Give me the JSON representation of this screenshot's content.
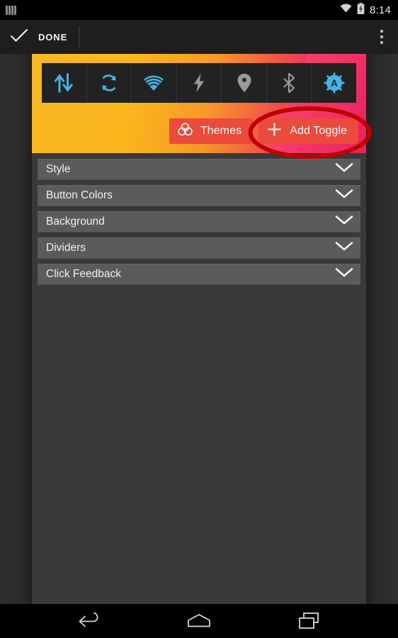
{
  "status_bar": {
    "notification_icon": "notification-bars-icon",
    "wifi_icon": "wifi-icon",
    "battery_icon": "battery-charging-icon",
    "time": "8:14"
  },
  "action_bar": {
    "done_icon": "check-icon",
    "done_label": "DONE",
    "overflow_icon": "overflow-menu-icon"
  },
  "preview": {
    "gradient_start": "#f7b823",
    "gradient_end": "#e81f60",
    "active_color": "#45b5e6",
    "inactive_color": "#9a9a9a",
    "toggle_bar_color": "#222222",
    "toggles": [
      {
        "name": "data-transfer-toggle",
        "icon": "data-transfer-icon",
        "state": "active"
      },
      {
        "name": "sync-toggle",
        "icon": "sync-icon",
        "state": "active"
      },
      {
        "name": "wifi-toggle",
        "icon": "wifi-icon",
        "state": "active"
      },
      {
        "name": "flashlight-toggle",
        "icon": "flash-icon",
        "state": "inactive"
      },
      {
        "name": "location-toggle",
        "icon": "location-pin-icon",
        "state": "inactive"
      },
      {
        "name": "bluetooth-toggle",
        "icon": "bluetooth-icon",
        "state": "inactive"
      },
      {
        "name": "auto-brightness-toggle",
        "icon": "auto-brightness-icon",
        "state": "active"
      }
    ],
    "themes_button": {
      "label": "Themes",
      "icon": "color-circles-icon",
      "color": "#ea4b3c"
    },
    "add_toggle_button": {
      "label": "Add Toggle",
      "icon": "plus-icon",
      "color": "#ea4b3c"
    }
  },
  "annotation": {
    "shape": "ellipse",
    "color": "#c00000",
    "target": "add-toggle-button"
  },
  "settings_list": {
    "chevron_icon": "chevron-down-icon",
    "rows": [
      {
        "label": "Style"
      },
      {
        "label": "Button Colors"
      },
      {
        "label": "Background"
      },
      {
        "label": "Dividers"
      },
      {
        "label": "Click Feedback"
      }
    ]
  },
  "nav_bar": {
    "back_icon": "back-arrow-icon",
    "home_icon": "home-icon",
    "recents_icon": "recents-icon"
  }
}
